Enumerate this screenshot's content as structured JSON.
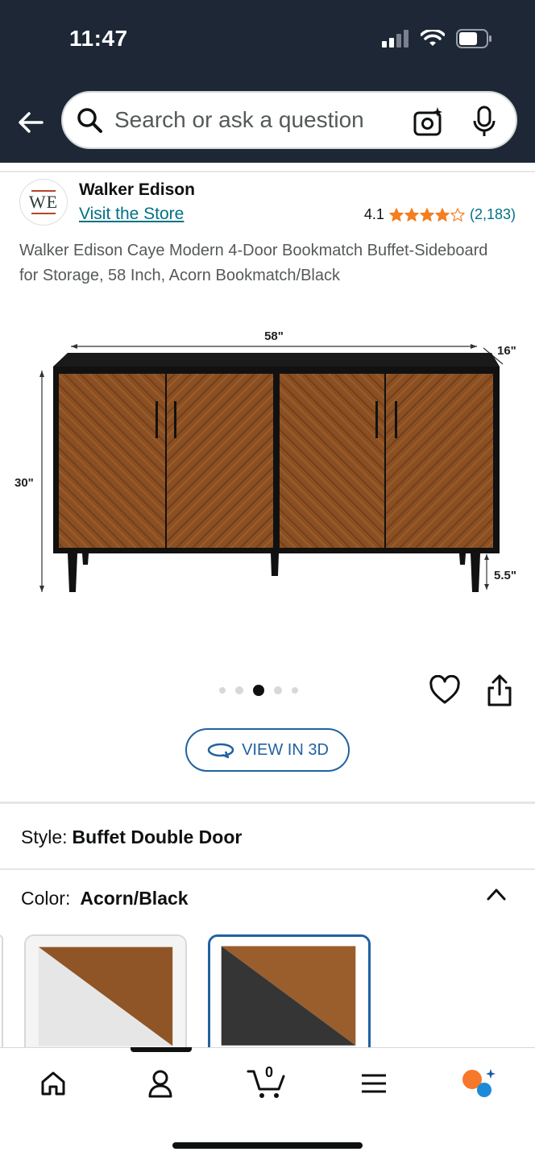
{
  "status_bar": {
    "time": "11:47"
  },
  "header": {
    "search_placeholder": "Search or ask a question",
    "icons": [
      "back-arrow-icon",
      "search-icon",
      "camera-icon",
      "microphone-icon"
    ]
  },
  "brand": {
    "logo_text": "WE",
    "name": "Walker Edison",
    "visit_store": "Visit the Store",
    "rating": "4.1",
    "stars_value": 4.1,
    "review_count": "(2,183)"
  },
  "product": {
    "title": "Walker Edison Caye Modern 4-Door Bookmatch Buffet-Sideboard for Storage, 58 Inch, Acorn Bookmatch/Black",
    "image": {
      "dim_width": "58\"",
      "dim_depth": "16\"",
      "dim_height": "30\"",
      "dim_leg": "5.5\""
    },
    "carousel": {
      "count": 5,
      "active_index": 2
    },
    "view_3d_label": "VIEW IN 3D"
  },
  "options": {
    "style_label": "Style:",
    "style_value": "Buffet Double Door",
    "color_label": "Color:",
    "color_value": "Acorn/Black"
  },
  "bottom_nav": {
    "cart_count": "0",
    "items": [
      "home-icon",
      "account-icon",
      "cart-icon",
      "menu-icon",
      "rufus-icon"
    ]
  },
  "colors": {
    "header_bg": "#1d2736",
    "link": "#007185",
    "accent_blue": "#2162a1",
    "star": "#f47e20"
  }
}
